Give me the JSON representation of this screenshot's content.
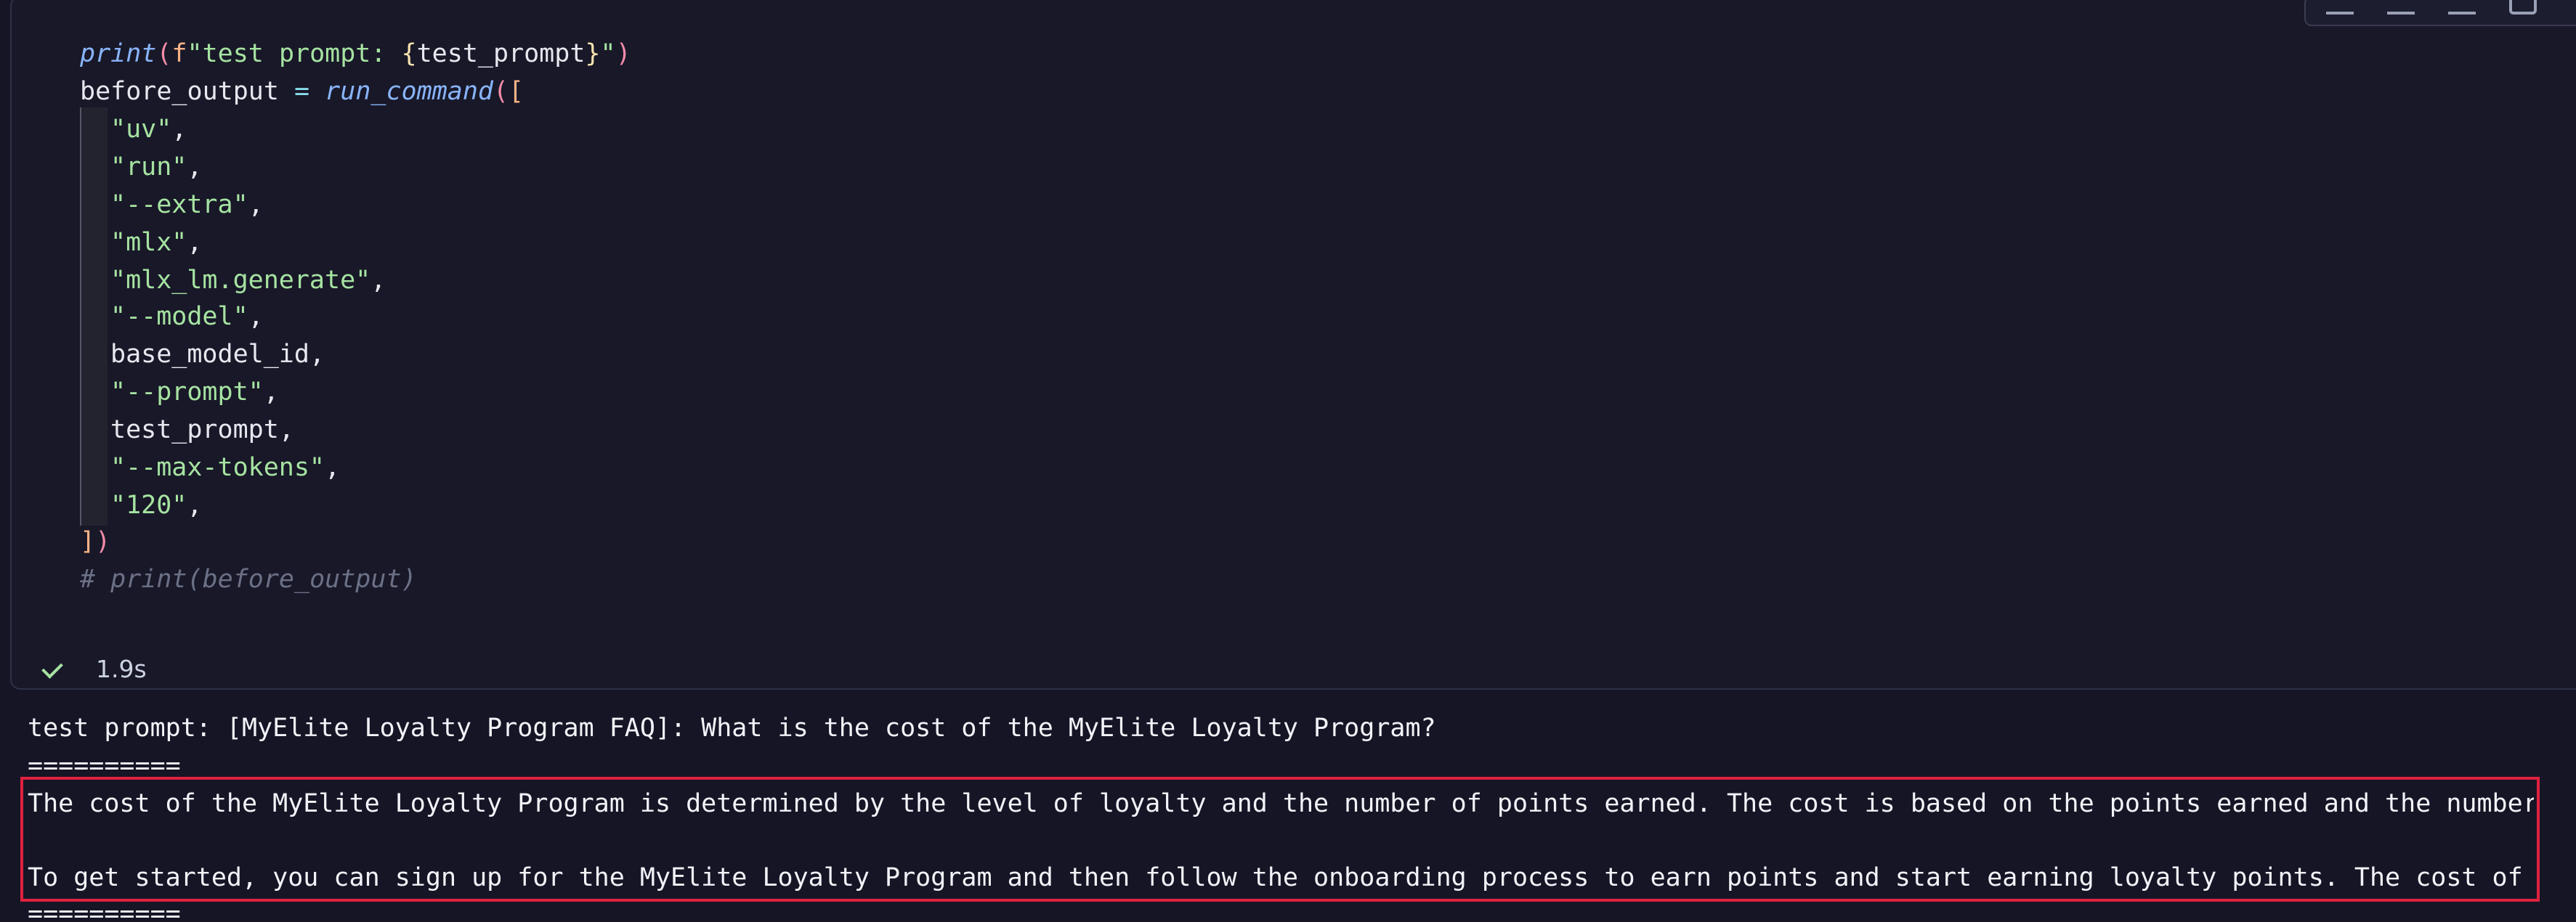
{
  "code_cell": {
    "lines": [
      {
        "kind": "print",
        "fn": "print",
        "open": "(",
        "fprefix": "f",
        "s1": "\"test prompt: ",
        "lbrace": "{",
        "var": "test_prompt",
        "rbrace": "}",
        "s2": "\"",
        "close": ")"
      },
      {
        "kind": "assign",
        "lhs": "before_output",
        "op": "=",
        "fn": "run_command",
        "open": "(",
        "open2": "["
      },
      {
        "kind": "str",
        "text": "\"uv\"",
        "comma": ","
      },
      {
        "kind": "str",
        "text": "\"run\"",
        "comma": ","
      },
      {
        "kind": "str",
        "text": "\"--extra\"",
        "comma": ","
      },
      {
        "kind": "str",
        "text": "\"mlx\"",
        "comma": ","
      },
      {
        "kind": "str",
        "text": "\"mlx_lm.generate\"",
        "comma": ","
      },
      {
        "kind": "str",
        "text": "\"--model\"",
        "comma": ","
      },
      {
        "kind": "ident",
        "text": "base_model_id",
        "comma": ","
      },
      {
        "kind": "str",
        "text": "\"--prompt\"",
        "comma": ","
      },
      {
        "kind": "ident",
        "text": "test_prompt",
        "comma": ","
      },
      {
        "kind": "str",
        "text": "\"--max-tokens\"",
        "comma": ","
      },
      {
        "kind": "str",
        "text": "\"120\"",
        "comma": ","
      },
      {
        "kind": "close",
        "close2": "]",
        "close": ")"
      },
      {
        "kind": "comment",
        "text": "# print(before_output)"
      }
    ],
    "status": {
      "icon": "check-icon",
      "duration": "1.9s"
    }
  },
  "output": {
    "prompt_line": "test prompt: [MyElite Loyalty Program FAQ]: What is the cost of the MyElite Loyalty Program?",
    "separator_top": "==========",
    "response_line_1": "The cost of the MyElite Loyalty Program is determined by the level of loyalty and the number of points earned. The cost is based on the points earned and the number of p",
    "response_line_2": "To get started, you can sign up for the MyElite Loyalty Program and then follow the onboarding process to earn points and start earning loyalty points. The cost of the M",
    "separator_bottom": "=========="
  },
  "colors": {
    "background": "#151526",
    "highlight_border": "#e0213d",
    "string": "#a6e3a1",
    "function": "#89b4fa",
    "comment": "#6c7086"
  }
}
